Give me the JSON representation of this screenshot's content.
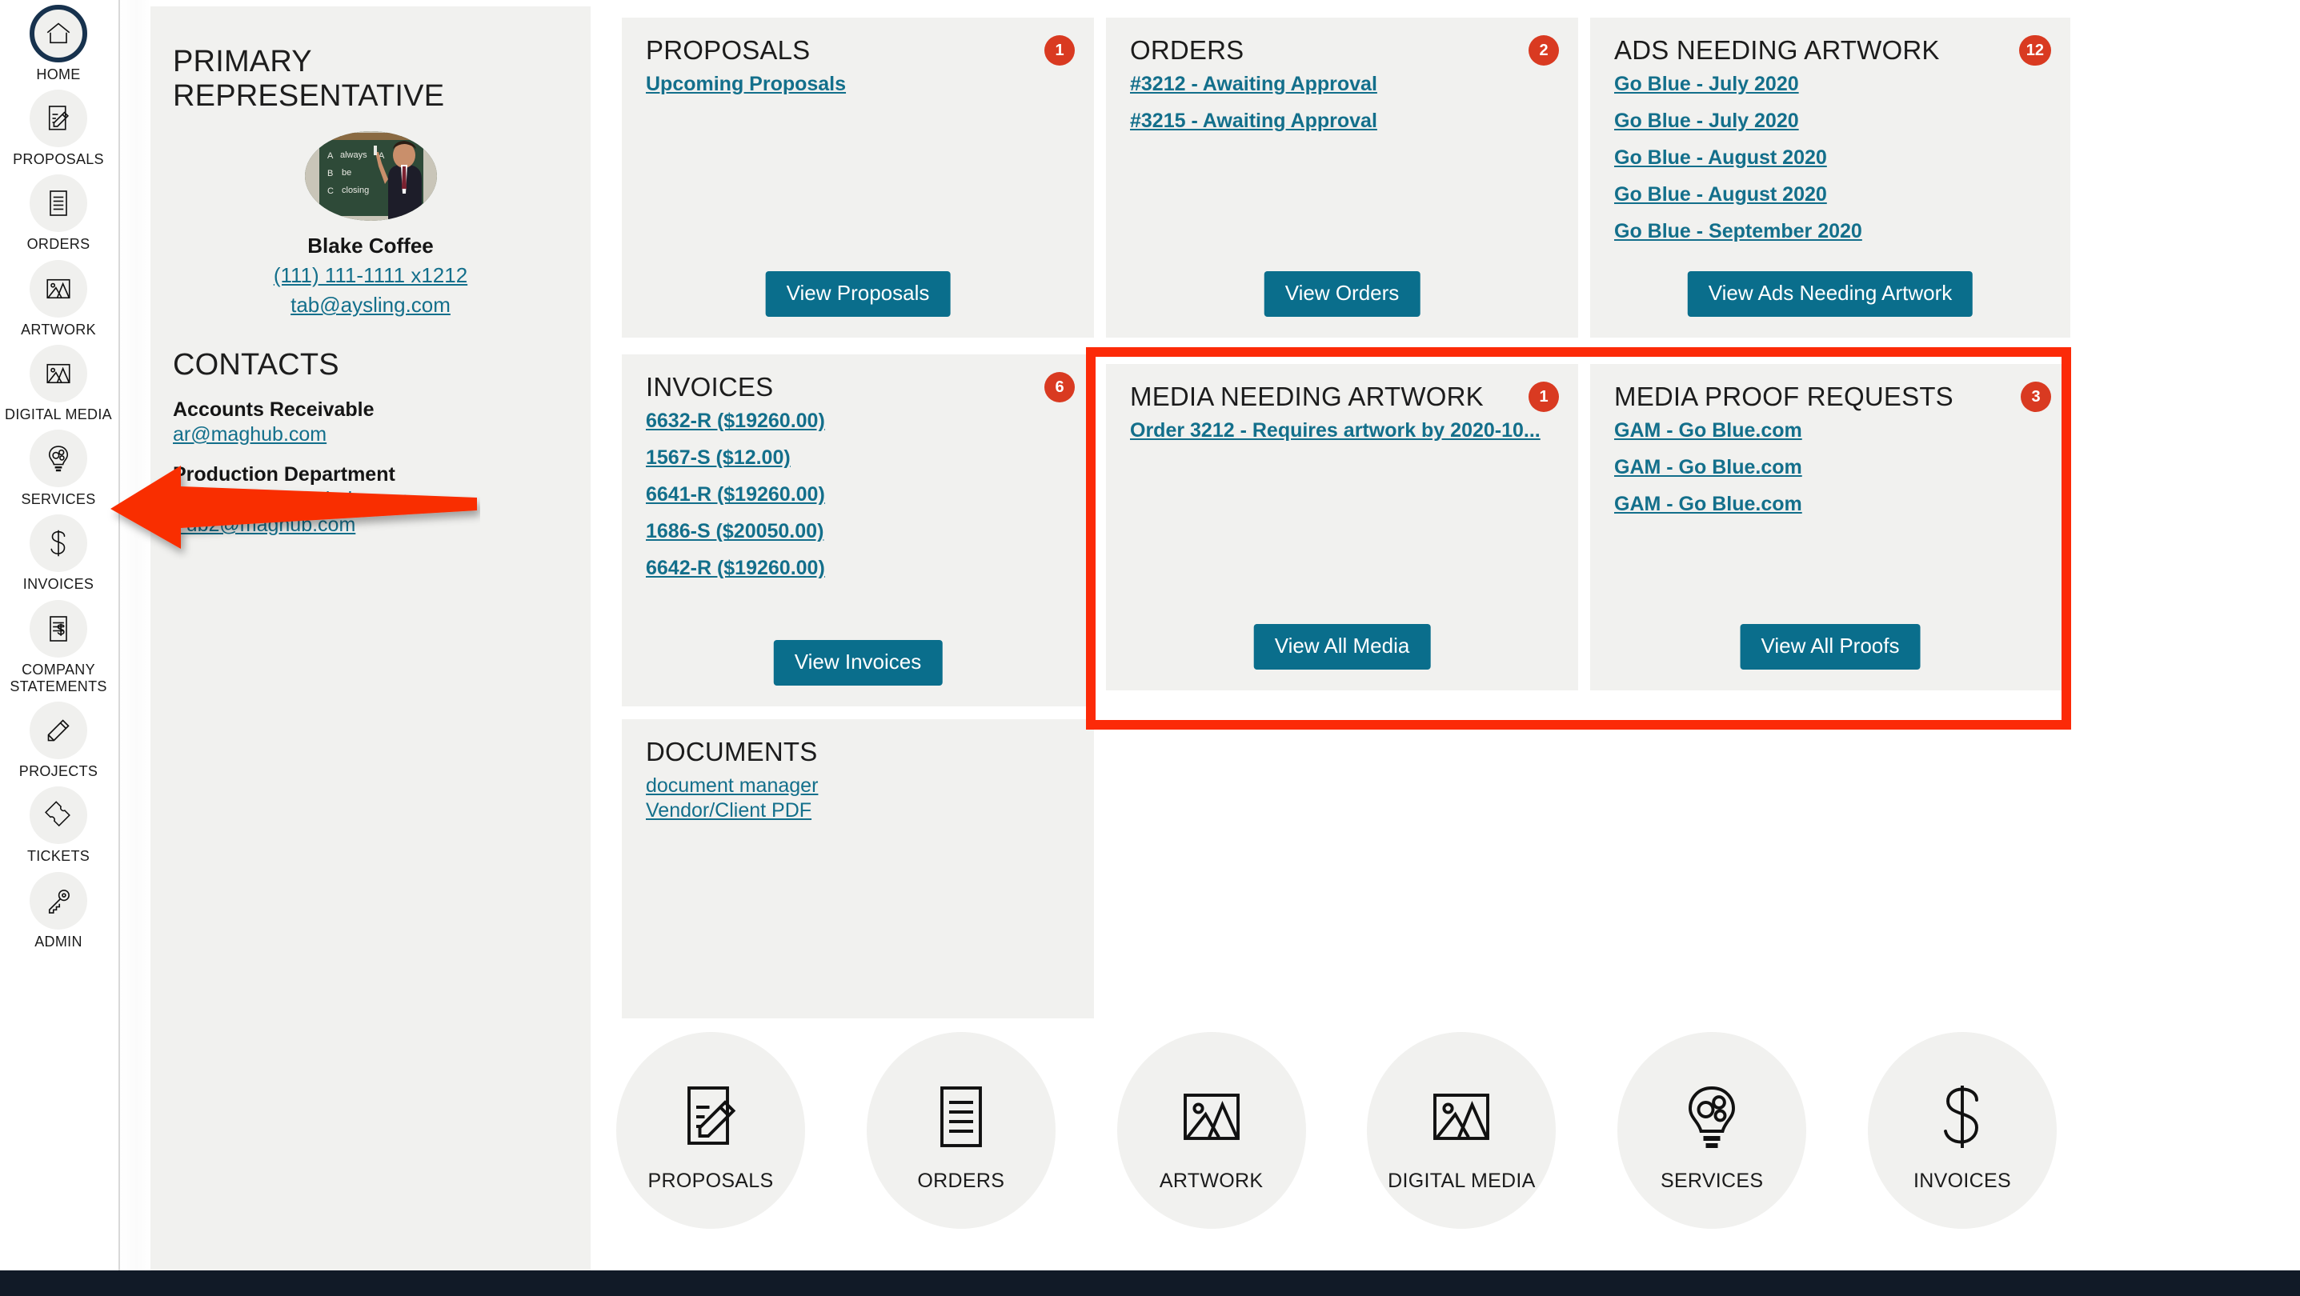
{
  "sidebar": {
    "items": [
      {
        "label": "HOME",
        "icon": "home-icon",
        "active": true
      },
      {
        "label": "PROPOSALS",
        "icon": "document-pencil-icon",
        "active": false
      },
      {
        "label": "ORDERS",
        "icon": "document-lines-icon",
        "active": false
      },
      {
        "label": "ARTWORK",
        "icon": "image-mountain-icon",
        "active": false
      },
      {
        "label": "DIGITAL MEDIA",
        "icon": "image-mountain-icon",
        "active": false
      },
      {
        "label": "SERVICES",
        "icon": "lightbulb-gears-icon",
        "active": false
      },
      {
        "label": "INVOICES",
        "icon": "dollar-sign-icon",
        "active": false
      },
      {
        "label": "COMPANY STATEMENTS",
        "icon": "document-dollar-icon",
        "active": false
      },
      {
        "label": "PROJECTS",
        "icon": "pencil-icon",
        "active": false
      },
      {
        "label": "TICKETS",
        "icon": "ticket-icon",
        "active": false
      },
      {
        "label": "ADMIN",
        "icon": "key-icon",
        "active": false
      }
    ]
  },
  "info_panel": {
    "primary_rep_heading": "PRIMARY REPRESENTATIVE",
    "rep_name": "Blake Coffee",
    "rep_phone": "(111) 111-1111 x1212",
    "rep_email": "tab@aysling.com",
    "contacts_heading": "CONTACTS",
    "contacts": [
      {
        "title": "Accounts Receivable",
        "emails": [
          "ar@maghub.com"
        ]
      },
      {
        "title": "Production Department",
        "emails": [
          "production@maghub.com;",
          "Pub2@maghub.com"
        ]
      }
    ]
  },
  "cards": {
    "proposals": {
      "title": "PROPOSALS",
      "badge": "1",
      "links": [
        "Upcoming Proposals"
      ],
      "button": "View Proposals"
    },
    "orders": {
      "title": "ORDERS",
      "badge": "2",
      "links": [
        "#3212 - Awaiting Approval",
        "#3215 - Awaiting Approval"
      ],
      "button": "View Orders"
    },
    "ads_needing_artwork": {
      "title": "ADS NEEDING ARTWORK",
      "badge": "12",
      "links": [
        "Go Blue - July 2020",
        "Go Blue - July 2020",
        "Go Blue - August 2020",
        "Go Blue - August 2020",
        "Go Blue - September 2020"
      ],
      "button": "View Ads Needing Artwork"
    },
    "invoices": {
      "title": "INVOICES",
      "badge": "6",
      "links": [
        "6632-R ($19260.00)",
        "1567-S ($12.00)",
        "6641-R ($19260.00)",
        "1686-S ($20050.00)",
        "6642-R ($19260.00)"
      ],
      "button": "View Invoices"
    },
    "media_needing_artwork": {
      "title": "MEDIA NEEDING ARTWORK",
      "badge": "1",
      "links": [
        "Order 3212 - Requires artwork by 2020-10..."
      ],
      "button": "View All Media"
    },
    "media_proof_requests": {
      "title": "MEDIA PROOF REQUESTS",
      "badge": "3",
      "links": [
        "GAM - Go Blue.com",
        "GAM - Go Blue.com",
        "GAM - Go Blue.com"
      ],
      "button": "View All Proofs"
    },
    "documents": {
      "title": "DOCUMENTS",
      "badge": "",
      "links": [
        "document manager",
        "Vendor/Client PDF"
      ],
      "button": ""
    }
  },
  "quick_links": [
    {
      "label": "PROPOSALS",
      "icon": "document-pencil-icon"
    },
    {
      "label": "ORDERS",
      "icon": "document-lines-icon"
    },
    {
      "label": "ARTWORK",
      "icon": "image-mountain-icon"
    },
    {
      "label": "DIGITAL MEDIA",
      "icon": "image-mountain-icon"
    },
    {
      "label": "SERVICES",
      "icon": "lightbulb-gears-icon"
    },
    {
      "label": "INVOICES",
      "icon": "dollar-sign-icon"
    }
  ],
  "annotations": {
    "highlight_color": "#fc2a08",
    "arrow_color": "#f92e06",
    "highlight_target": "media-cards",
    "arrow_target": "sidebar-item-digital-media"
  },
  "colors": {
    "accent_button": "#0a6e8c",
    "link": "#136f8b",
    "badge": "#d93a21",
    "card_bg": "#f1f1ef",
    "footer": "#111a27"
  }
}
